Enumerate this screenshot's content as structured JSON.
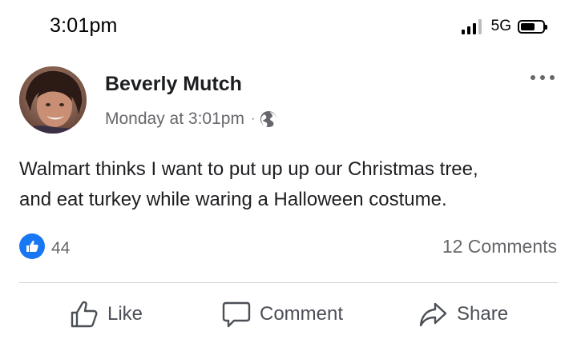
{
  "status_bar": {
    "time": "3:01pm",
    "network": "5G",
    "icons": [
      "signal-icon",
      "battery-icon"
    ]
  },
  "post": {
    "author": "Beverly Mutch",
    "timestamp": "Monday at 3:01pm",
    "separator": "·",
    "privacy_icon": "globe-icon",
    "text_line1": "Walmart thinks I want to put up up our Christmas tree,",
    "text_line2": "and eat turkey while waring a Halloween costume.",
    "reactions": {
      "icon": "like-reaction-icon",
      "count": "44"
    },
    "comments_label": "12 Comments"
  },
  "actions": {
    "like": "Like",
    "comment": "Comment",
    "share": "Share"
  },
  "colors": {
    "accent": "#1877f2",
    "secondary_text": "#65676b",
    "primary_text": "#1c1e21"
  }
}
